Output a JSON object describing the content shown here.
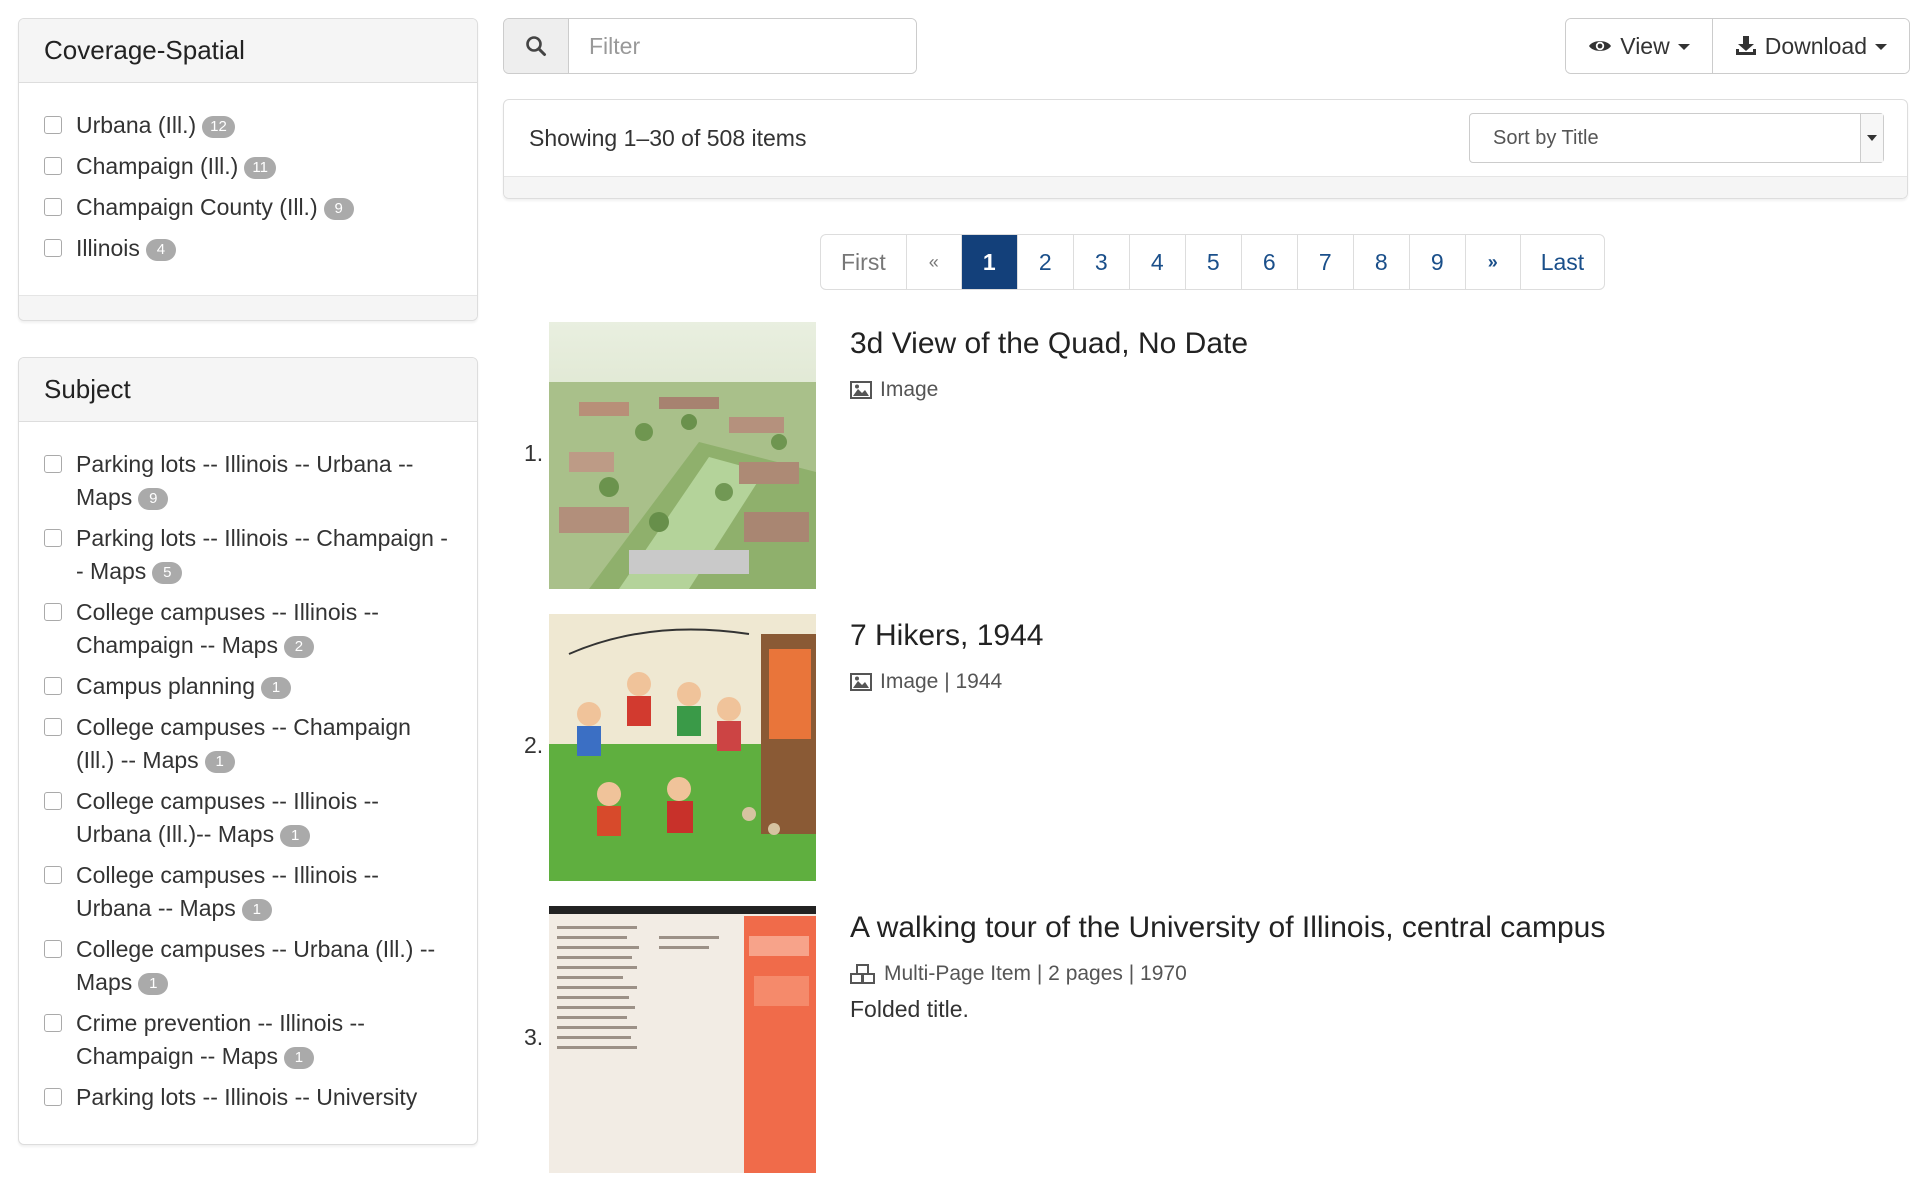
{
  "facets": {
    "coverage": {
      "heading": "Coverage-Spatial",
      "items": [
        {
          "label": "Urbana (Ill.)",
          "count": "12"
        },
        {
          "label": "Champaign (Ill.)",
          "count": "11"
        },
        {
          "label": "Champaign County (Ill.)",
          "count": "9"
        },
        {
          "label": "Illinois",
          "count": "4"
        }
      ]
    },
    "subject": {
      "heading": "Subject",
      "items": [
        {
          "label": "Parking lots -- Illinois -- Urbana -- Maps",
          "count": "9"
        },
        {
          "label": "Parking lots -- Illinois -- Champaign -- Maps",
          "count": "5"
        },
        {
          "label": "College campuses -- Illinois -- Champaign -- Maps",
          "count": "2"
        },
        {
          "label": "Campus planning",
          "count": "1"
        },
        {
          "label": "College campuses -- Champaign (Ill.) -- Maps",
          "count": "1"
        },
        {
          "label": "College campuses -- Illinois -- Urbana (Ill.)-- Maps",
          "count": "1"
        },
        {
          "label": "College campuses -- Illinois -- Urbana -- Maps",
          "count": "1"
        },
        {
          "label": "College campuses -- Urbana (Ill.) -- Maps",
          "count": "1"
        },
        {
          "label": "Crime prevention -- Illinois -- Champaign -- Maps",
          "count": "1"
        },
        {
          "label": "Parking lots -- Illinois -- University",
          "count": ""
        }
      ]
    }
  },
  "toolbar": {
    "filter_placeholder": "Filter",
    "view_label": "View",
    "download_label": "Download"
  },
  "results_header": {
    "showing": "Showing 1–30 of 508 items",
    "sort_label": "Sort by Title"
  },
  "pagination": {
    "first": "First",
    "prev": "«",
    "pages": [
      "1",
      "2",
      "3",
      "4",
      "5",
      "6",
      "7",
      "8",
      "9"
    ],
    "active": "1",
    "next": "»",
    "last": "Last"
  },
  "results": [
    {
      "index": "1.",
      "title": "3d View of the Quad, No Date",
      "meta": "Image",
      "description": "",
      "icon": "image-icon"
    },
    {
      "index": "2.",
      "title": "7 Hikers, 1944",
      "meta": "Image | 1944",
      "description": "",
      "icon": "image-icon"
    },
    {
      "index": "3.",
      "title": "A walking tour of the University of Illinois, central campus",
      "meta": "Multi-Page Item | 2 pages | 1970",
      "description": "Folded title.",
      "icon": "cubes-icon"
    }
  ],
  "colors": {
    "accent": "#13407a",
    "link": "#1a4f8a",
    "badge": "#aaaaaa"
  }
}
